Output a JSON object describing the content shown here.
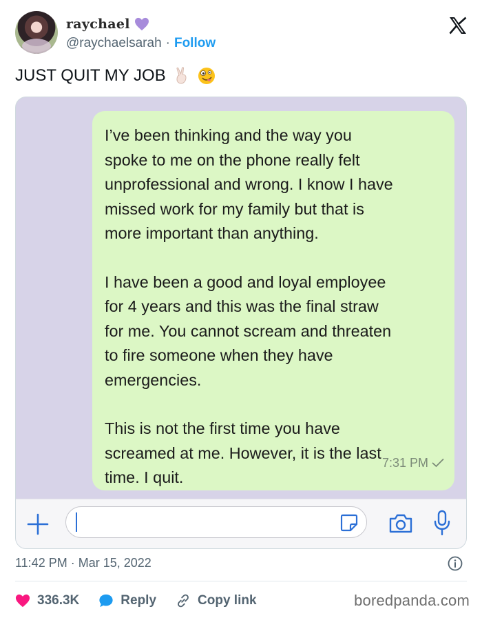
{
  "user": {
    "display_name": "raychael",
    "handle": "@raychaelsarah",
    "separator": "·",
    "follow_label": "Follow",
    "badge_color": "#a78bdb"
  },
  "tweet": {
    "text": "JUST QUIT MY JOB",
    "emojis": [
      "victory-hand",
      "zany-face"
    ],
    "time": "11:42 PM",
    "separator": "·",
    "date": "Mar 15, 2022"
  },
  "message": {
    "paragraphs": [
      "I’ve been thinking and the way you\nspoke to me on the phone really felt\nunprofessional and wrong. I know I have\nmissed work for my family but that is\nmore important than anything.",
      "I have been a good and loyal employee\nfor 4 years and this was the final straw\nfor me. You cannot scream and threaten\nto fire someone when they have\nemergencies.",
      "This is not the first time you have\nscreamed at me. However, it is the last\ntime. I quit."
    ],
    "time": "7:31 PM",
    "bubble_color": "#dcf7c5",
    "background_color": "#d7d3e8"
  },
  "actions": {
    "likes": "336.3K",
    "reply_label": "Reply",
    "copy_link_label": "Copy link"
  },
  "watermark": "boredpanda.com",
  "colors": {
    "like": "#f91880",
    "reply": "#1d9bf0",
    "link": "#1d9bf0",
    "ios_blue": "#2b6fd6"
  }
}
